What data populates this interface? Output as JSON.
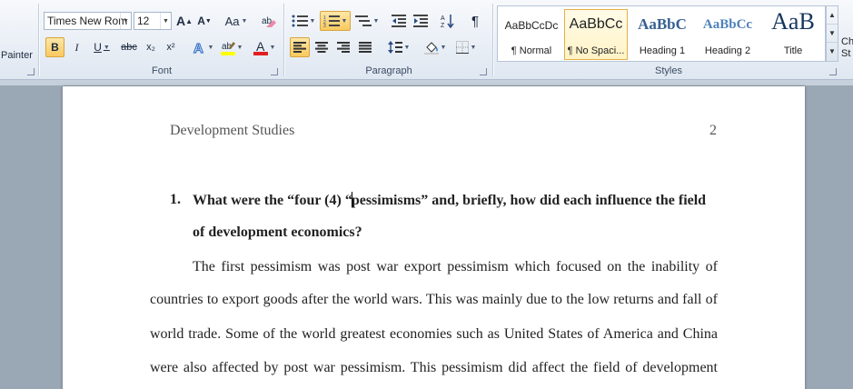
{
  "ribbon": {
    "clipboard": {
      "painter_label": "Painter"
    },
    "font": {
      "group_label": "Font",
      "font_name": "Times New Rom",
      "font_size": "12",
      "grow_label": "A",
      "shrink_label": "A",
      "case_label": "Aa",
      "bold": "B",
      "italic": "I",
      "underline": "U",
      "strike": "abc",
      "subscript": "x₂",
      "superscript": "x²",
      "font_color_label": "A"
    },
    "paragraph": {
      "group_label": "Paragraph",
      "pilcrow": "¶"
    },
    "styles": {
      "group_label": "Styles",
      "items": [
        {
          "sample": "AaBbCcDc",
          "name": "¶ Normal"
        },
        {
          "sample": "AaBbCc",
          "name": "¶ No Spaci..."
        },
        {
          "sample": "AaBbC",
          "name": "Heading 1"
        },
        {
          "sample": "AaBbCc",
          "name": "Heading 2"
        },
        {
          "sample": "AaB",
          "name": "Title"
        }
      ],
      "edge_labels": [
        "Ch",
        "St"
      ]
    },
    "colors": {
      "accent_active": "#f9c95f",
      "heading": "#365f91",
      "heading2": "#4f81bd",
      "title": "#17365d",
      "font_red": "#e02020",
      "highlight_yellow": "#ffff00"
    }
  },
  "document": {
    "header_left": "Development Studies",
    "header_right": "2",
    "question_number": "1.",
    "question_line1_a": "What were the “four (4) “",
    "question_line1_b": "pessimisms”  and, briefly, how did each influence the field",
    "question_line2": "of development economics?",
    "body_lines": [
      "The first pessimism was post war export pessimism which focused on the inability of",
      "countries to export goods after the world wars. This was mainly due to the low returns and fall of",
      "world trade. Some of the world greatest economies such as United States of America and China",
      "were also affected by post war pessimism. This pessimism did affect the field of development"
    ]
  }
}
